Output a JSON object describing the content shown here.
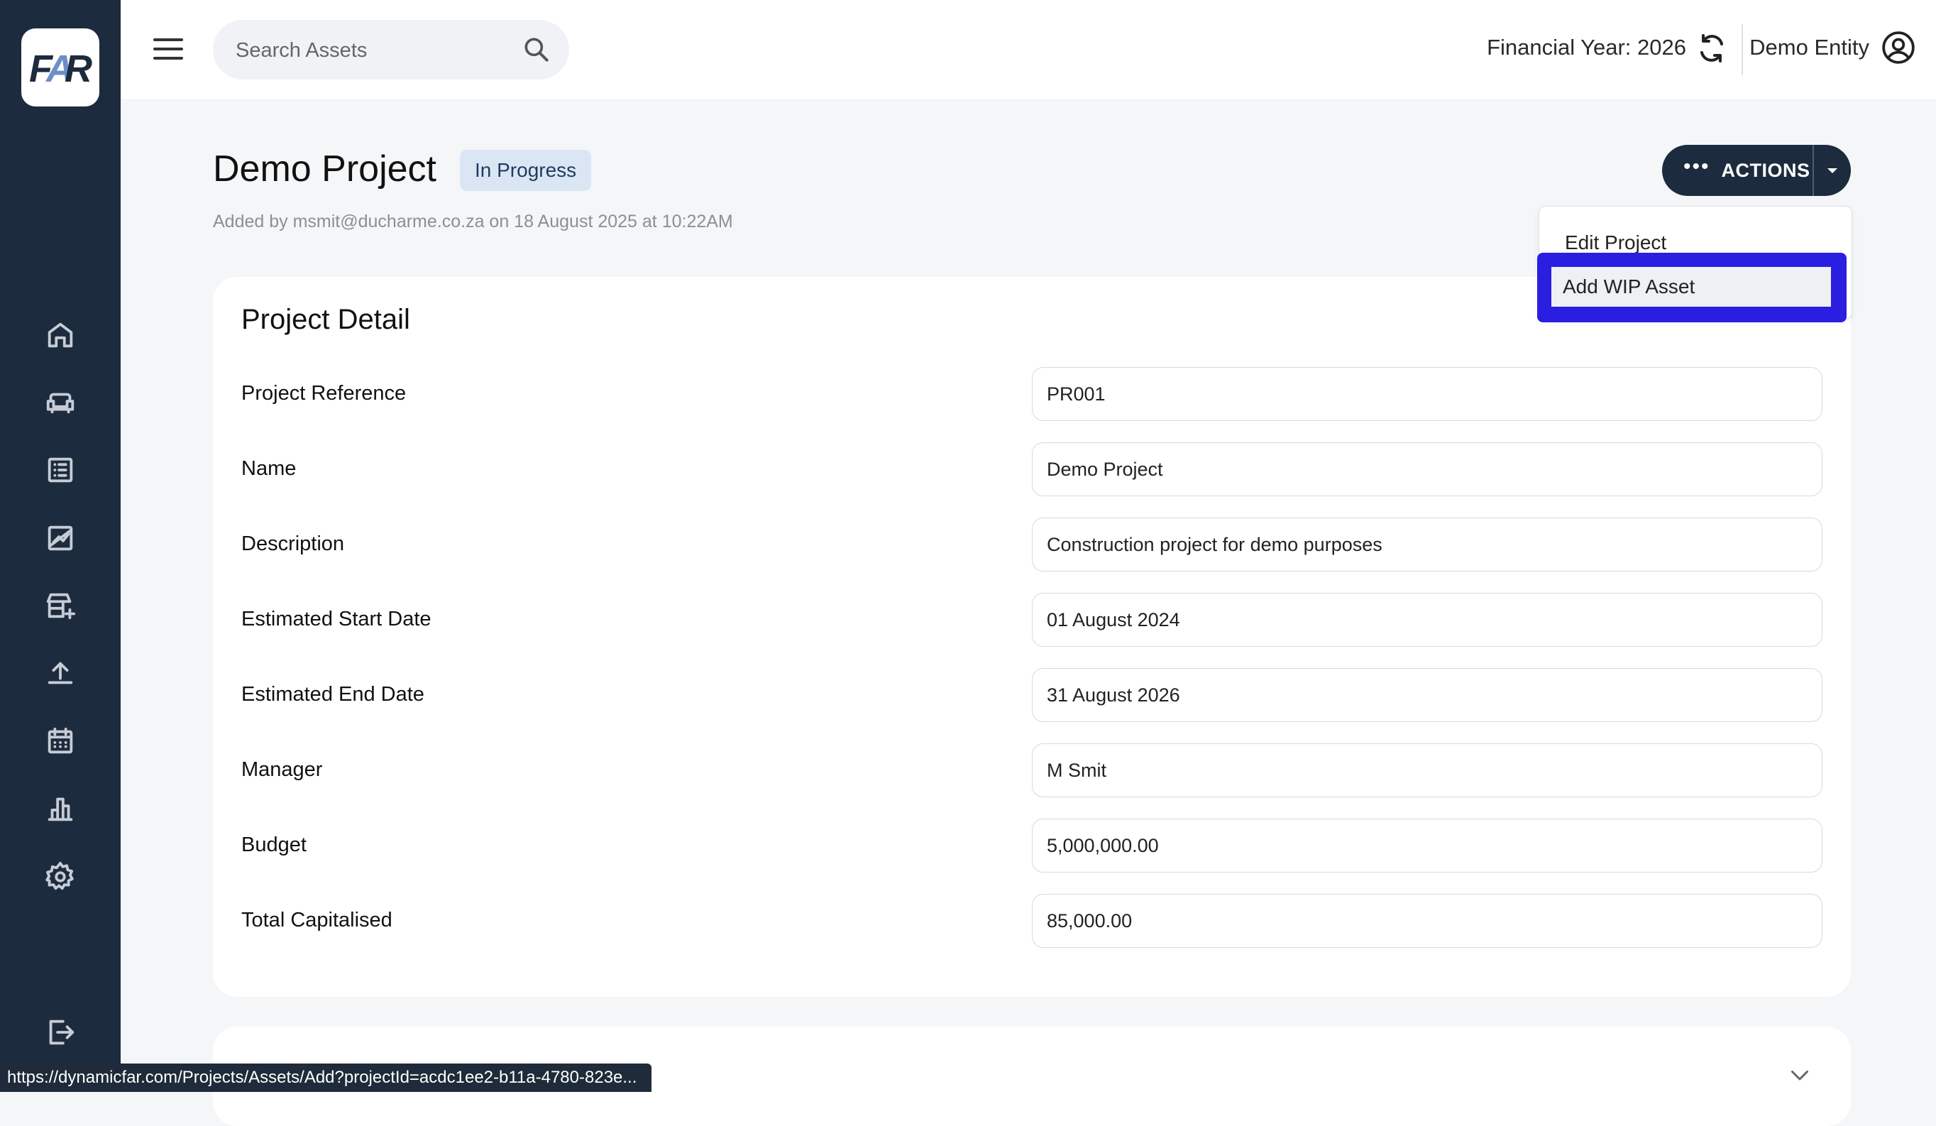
{
  "app": {
    "logo_text": "FAR"
  },
  "topbar": {
    "search_placeholder": "Search Assets",
    "financial_year": "Financial Year: 2026",
    "entity": "Demo Entity"
  },
  "sidebar": {
    "items": [
      {
        "icon": "home-icon"
      },
      {
        "icon": "sofa-icon"
      },
      {
        "icon": "list-icon"
      },
      {
        "icon": "chart-icon"
      },
      {
        "icon": "store-add-icon"
      },
      {
        "icon": "upload-icon"
      },
      {
        "icon": "calendar-icon"
      },
      {
        "icon": "bar-chart-icon"
      },
      {
        "icon": "gear-icon"
      }
    ],
    "logout_icon": "logout-icon"
  },
  "header": {
    "title": "Demo Project",
    "status": "In Progress",
    "added_by": "Added by msmit@ducharme.co.za on 18 August 2025 at 10:22AM",
    "actions_label": "ACTIONS"
  },
  "actions_menu": {
    "items": [
      "Edit Project",
      "Add WIP Asset"
    ],
    "selected": "Add WIP Asset"
  },
  "project_detail": {
    "title": "Project Detail",
    "rows": [
      {
        "label": "Project Reference",
        "value": "PR001"
      },
      {
        "label": "Name",
        "value": "Demo Project"
      },
      {
        "label": "Description",
        "value": "Construction project for demo purposes"
      },
      {
        "label": "Estimated Start Date",
        "value": "01 August 2024"
      },
      {
        "label": "Estimated End Date",
        "value": "31 August 2026"
      },
      {
        "label": "Manager",
        "value": "M Smit"
      },
      {
        "label": "Budget",
        "value": "5,000,000.00"
      },
      {
        "label": "Total Capitalised",
        "value": "85,000.00"
      }
    ]
  },
  "status_bar": {
    "url": "https://dynamicfar.com/Projects/Assets/Add?projectId=acdc1ee2-b11a-4780-823e..."
  },
  "colors": {
    "sidebar_bg": "#1c2b3d",
    "highlight": "#2a1ee0",
    "badge_bg": "#dbe6f5"
  }
}
